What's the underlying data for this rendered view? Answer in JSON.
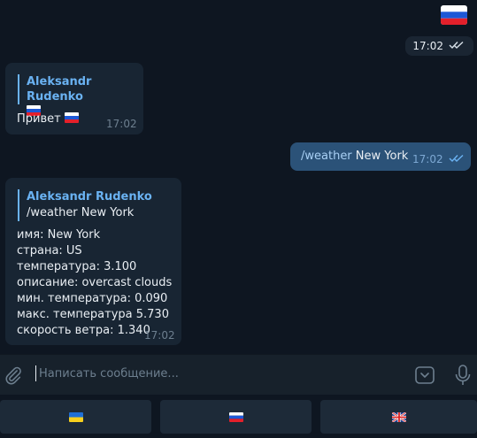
{
  "top_message": {
    "flag": "russia-flag",
    "time": "17:02",
    "status": "read"
  },
  "messages": [
    {
      "id": "m1",
      "reply_author": "Aleksandr Rudenko",
      "reply_flag": "russia-flag",
      "text": "Привет",
      "text_flag": "russia-flag",
      "time": "17:02"
    },
    {
      "id": "m2",
      "command": "/weather",
      "text": "New York",
      "time": "17:02",
      "status": "read"
    },
    {
      "id": "m3",
      "reply_author": "Aleksandr Rudenko",
      "reply_text": "/weather New York",
      "lines": [
        "имя: New York",
        "страна: US",
        "температура: 3.100",
        "описание: overcast clouds",
        "мин. температура: 0.090",
        "макс. температура 5.730",
        "скорость ветра: 1.340"
      ],
      "time": "17:02"
    }
  ],
  "composer": {
    "placeholder": "Написать сообщение..."
  },
  "keyboard": {
    "buttons": [
      {
        "flag": "ukraine-flag"
      },
      {
        "flag": "russia-flag"
      },
      {
        "flag": "uk-flag"
      }
    ]
  },
  "colors": {
    "background": "#0e1621",
    "incoming_bubble": "#182533",
    "outgoing_bubble": "#2b5278",
    "accent": "#6ab2f2"
  }
}
